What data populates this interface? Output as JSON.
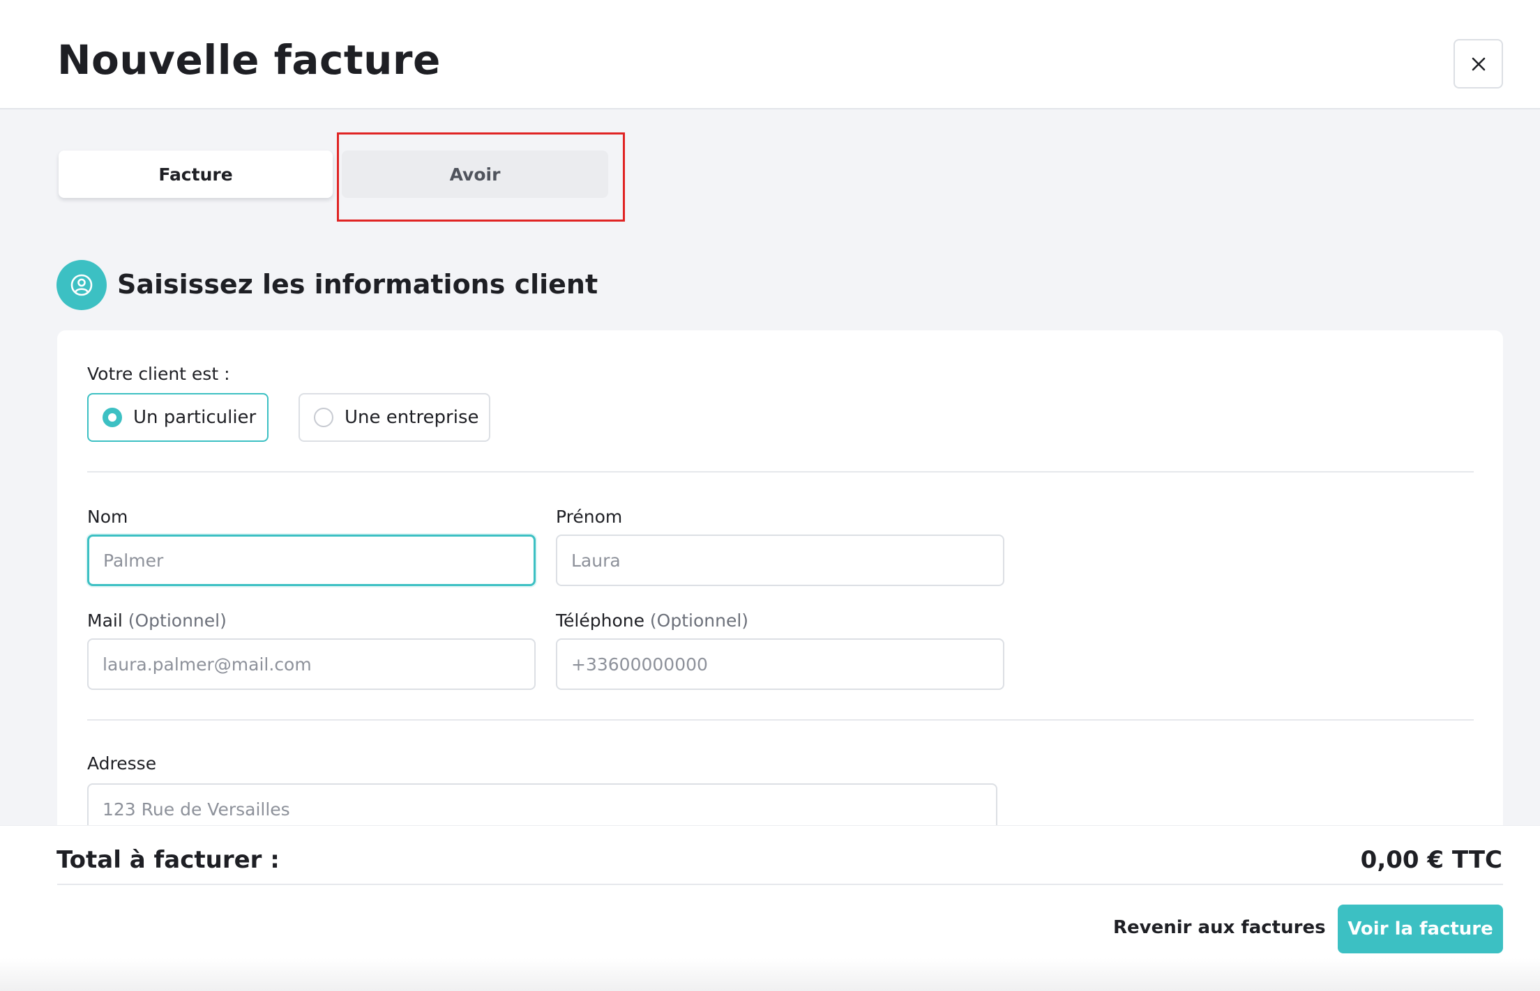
{
  "header": {
    "title": "Nouvelle facture",
    "close_icon": "close-icon"
  },
  "tabs": [
    {
      "label": "Facture",
      "selected": true
    },
    {
      "label": "Avoir",
      "selected": false
    }
  ],
  "client_section": {
    "title": "Saisissez les informations client",
    "icon": "user-circle-icon",
    "client_type_label": "Votre client est :",
    "client_type_options": [
      {
        "label": "Un particulier",
        "checked": true
      },
      {
        "label": "Une entreprise",
        "checked": false
      }
    ],
    "fields": {
      "nom": {
        "label": "Nom",
        "placeholder": "Palmer",
        "value": ""
      },
      "prenom": {
        "label": "Prénom",
        "placeholder": "Laura",
        "value": ""
      },
      "mail": {
        "label": "Mail",
        "optional": "(Optionnel)",
        "placeholder": "laura.palmer@mail.com",
        "value": ""
      },
      "telephone": {
        "label": "Téléphone",
        "optional": "(Optionnel)",
        "placeholder": "+33600000000",
        "value": ""
      },
      "adresse": {
        "label": "Adresse",
        "placeholder": "123 Rue de Versailles",
        "value": ""
      }
    }
  },
  "footer": {
    "total_label": "Total à facturer :",
    "total_value": "0,00 € TTC",
    "back_label": "Revenir aux factures",
    "primary_label": "Voir la facture"
  },
  "colors": {
    "accent": "#3cc0c3",
    "highlight": "#e02424",
    "background": "#f3f4f7"
  }
}
